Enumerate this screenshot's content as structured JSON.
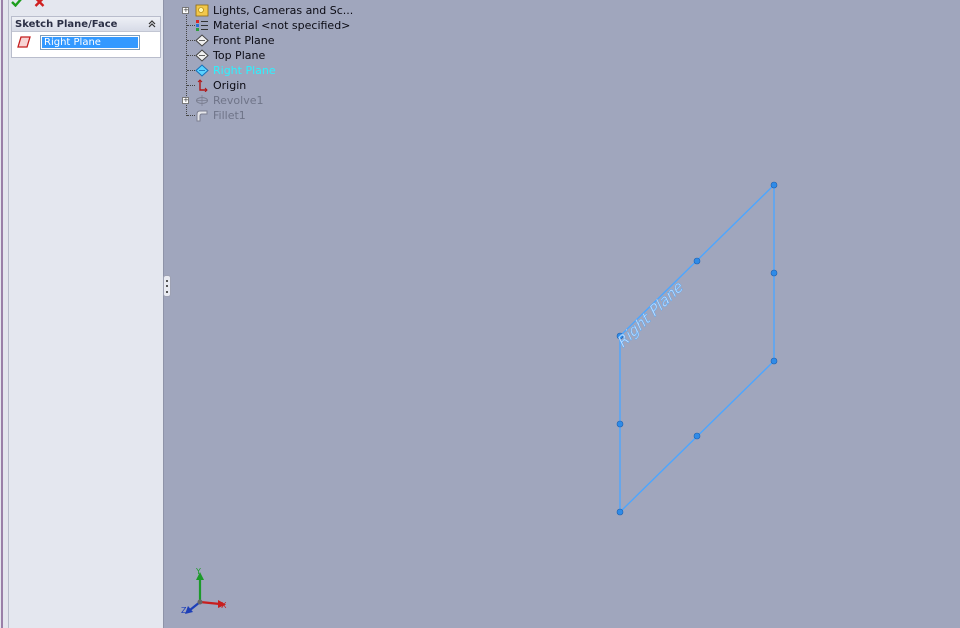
{
  "property_manager": {
    "group_title": "Sketch Plane/Face",
    "selection": "Right Plane"
  },
  "feature_tree": {
    "items": [
      {
        "label": "Lights, Cameras and Sc...",
        "icon": "lights-cameras-scene-icon",
        "expander": true,
        "state": "normal"
      },
      {
        "label": "Material <not specified>",
        "icon": "material-icon",
        "expander": false,
        "state": "normal"
      },
      {
        "label": "Front Plane",
        "icon": "plane-icon",
        "expander": false,
        "state": "normal"
      },
      {
        "label": "Top Plane",
        "icon": "plane-icon",
        "expander": false,
        "state": "normal"
      },
      {
        "label": "Right Plane",
        "icon": "plane-icon",
        "expander": false,
        "state": "selected"
      },
      {
        "label": "Origin",
        "icon": "origin-icon",
        "expander": false,
        "state": "normal"
      },
      {
        "label": "Revolve1",
        "icon": "revolve-icon",
        "expander": true,
        "state": "suppressed"
      },
      {
        "label": "Fillet1",
        "icon": "fillet-icon",
        "expander": false,
        "state": "suppressed"
      }
    ]
  },
  "viewport": {
    "plane_label": "Right Plane",
    "plane_color": "#4da6ff",
    "background_color": "#a0a6bd"
  },
  "triad": {
    "x_label": "X",
    "y_label": "Y",
    "z_label": "Z"
  }
}
